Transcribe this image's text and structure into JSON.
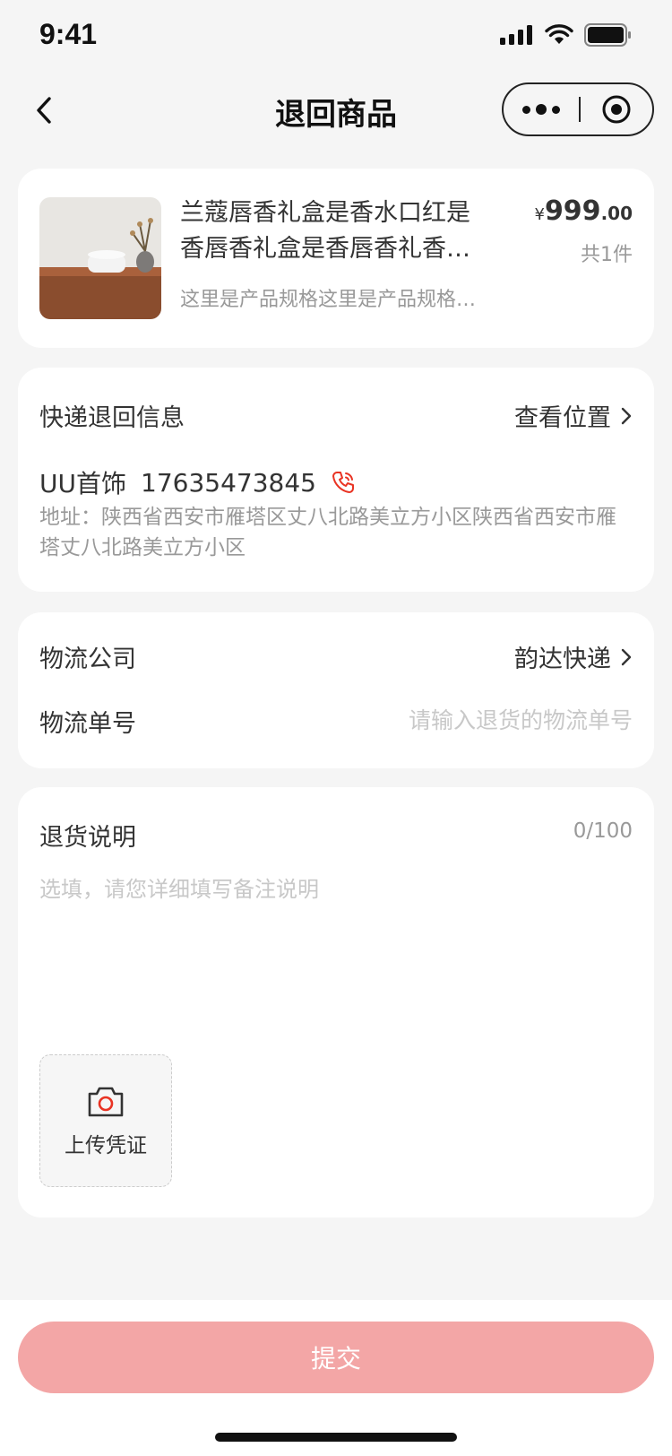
{
  "status_bar": {
    "time": "9:41"
  },
  "nav": {
    "title": "退回商品"
  },
  "product": {
    "name": "兰蔻唇香礼盒是香水口红是香唇香礼盒是香唇香礼香水口红",
    "spec": "这里是产品规格这里是产品规格这里是产品规格",
    "price_symbol": "¥",
    "price_int": "999",
    "price_dec": ".00",
    "count": "共1件"
  },
  "return_info": {
    "title": "快递退回信息",
    "view_location": "查看位置",
    "contact_name": "UU首饰",
    "phone": "17635473845",
    "address": "地址：陕西省西安市雁塔区丈八北路美立方小区陕西省西安市雁塔丈八北路美立方小区"
  },
  "logistics": {
    "company_label": "物流公司",
    "company_value": "韵达快递",
    "number_label": "物流单号",
    "number_placeholder": "请输入退货的物流单号"
  },
  "remark": {
    "label": "退货说明",
    "counter": "0/100",
    "placeholder": "选填，请您详细填写备注说明",
    "upload_label": "上传凭证"
  },
  "submit": {
    "label": "提交"
  },
  "colors": {
    "accent": "#e93323",
    "button_disabled": "#f3a6a6",
    "background": "#f5f5f5"
  }
}
